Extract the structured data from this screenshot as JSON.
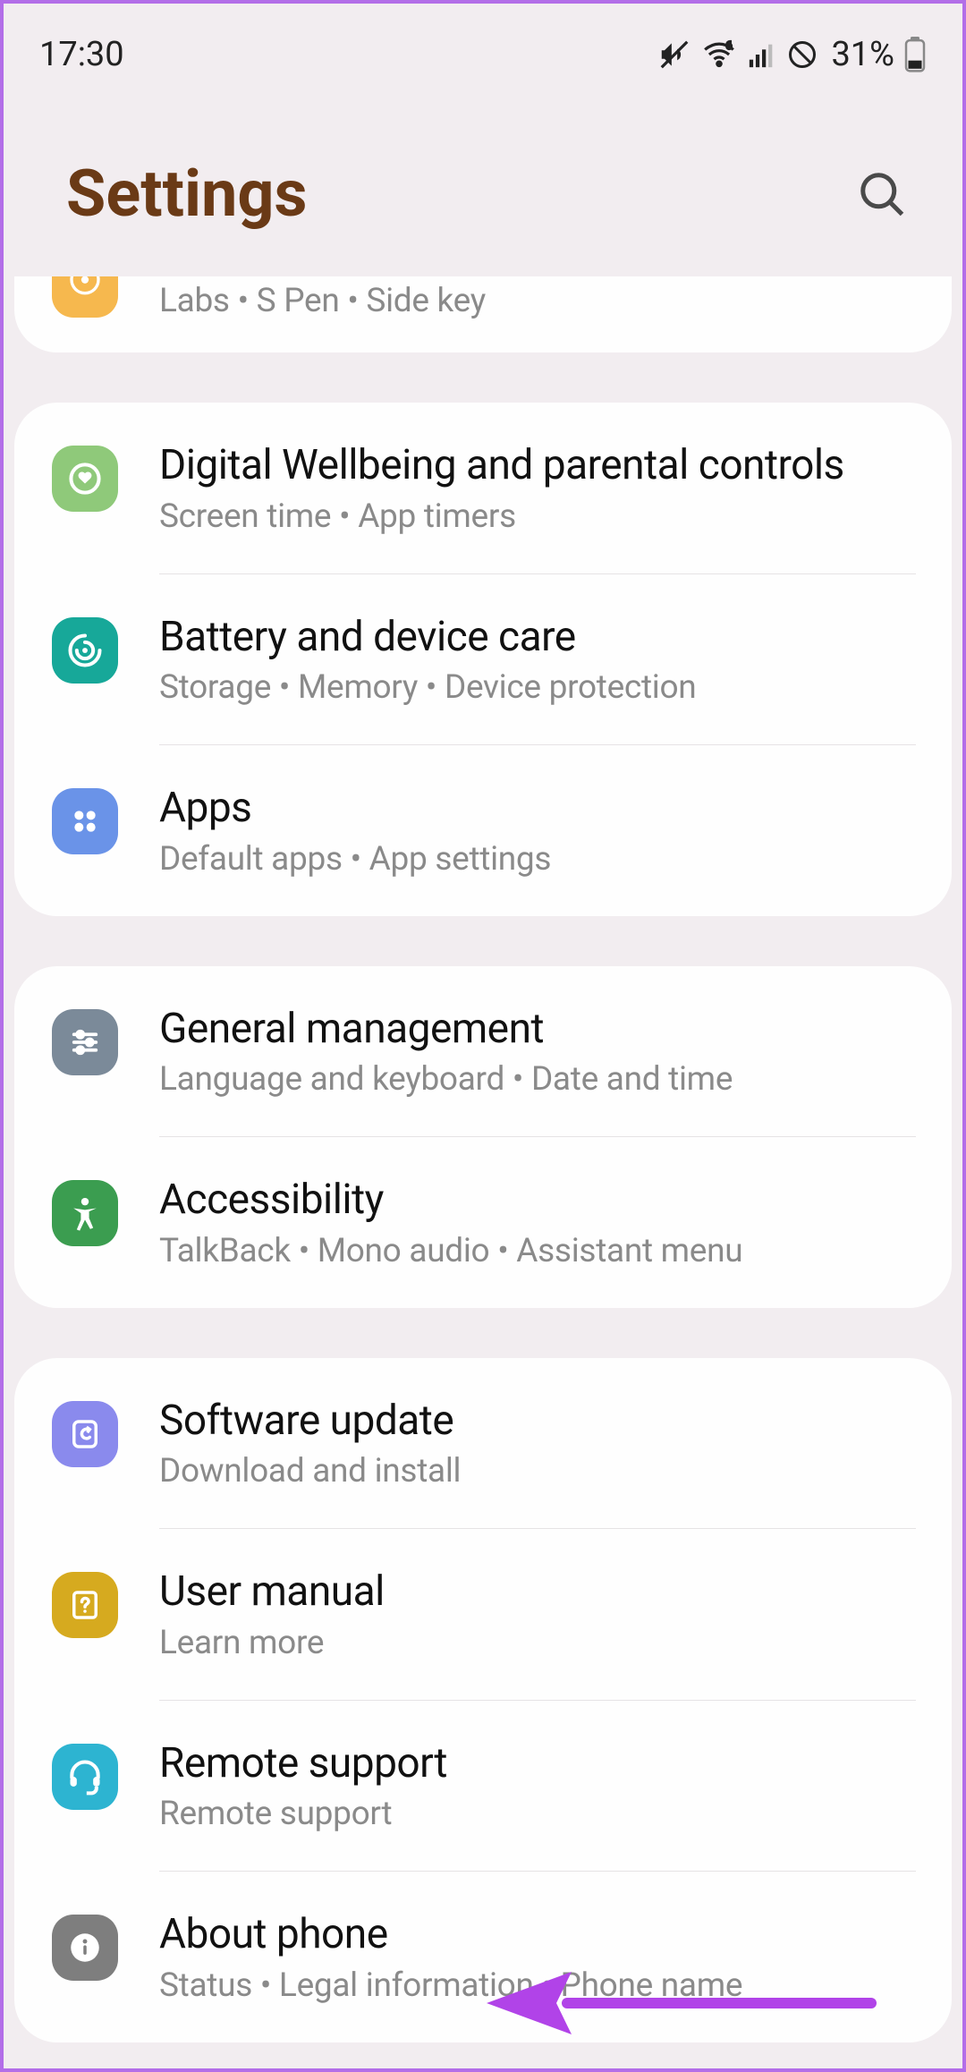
{
  "status": {
    "time": "17:30",
    "battery": "31%"
  },
  "header": {
    "title": "Settings"
  },
  "groups": [
    {
      "partial": true,
      "items": [
        {
          "key": "advanced",
          "subtitle": "Labs  •  S Pen  •  Side key"
        }
      ]
    },
    {
      "items": [
        {
          "key": "wellbeing",
          "title": "Digital Wellbeing and parental controls",
          "subtitle": "Screen time  •  App timers"
        },
        {
          "key": "battery",
          "title": "Battery and device care",
          "subtitle": "Storage  •  Memory  •  Device protection"
        },
        {
          "key": "apps",
          "title": "Apps",
          "subtitle": "Default apps  •  App settings"
        }
      ]
    },
    {
      "items": [
        {
          "key": "general",
          "title": "General management",
          "subtitle": "Language and keyboard  •  Date and time"
        },
        {
          "key": "accessibility",
          "title": "Accessibility",
          "subtitle": "TalkBack  •  Mono audio  •  Assistant menu"
        }
      ]
    },
    {
      "items": [
        {
          "key": "update",
          "title": "Software update",
          "subtitle": "Download and install"
        },
        {
          "key": "manual",
          "title": "User manual",
          "subtitle": "Learn more"
        },
        {
          "key": "remote",
          "title": "Remote support",
          "subtitle": "Remote support"
        },
        {
          "key": "about",
          "title": "About phone",
          "subtitle": "Status  •  Legal information  •  Phone name"
        }
      ]
    }
  ]
}
